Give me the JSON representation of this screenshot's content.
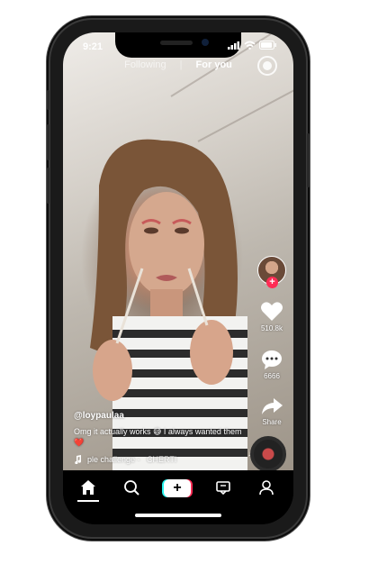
{
  "status_bar": {
    "time": "9:21"
  },
  "top_nav": {
    "following_label": "Following",
    "for_you_label": "For you"
  },
  "sidebar": {
    "follow_symbol": "+",
    "likes_count": "510.8k",
    "comments_count": "6666",
    "share_label": "Share"
  },
  "caption": {
    "username": "@loypaulaa",
    "description": "Omg it actually works 😅 I always wanted them ❤️",
    "music_text": "ple challenge -   CHERTI"
  },
  "bottom_nav": {
    "items": [
      "home-icon",
      "discover-icon",
      "create-icon",
      "inbox-icon",
      "profile-icon"
    ],
    "create_symbol": "+"
  },
  "colors": {
    "accent_red": "#fe2c55",
    "accent_cyan": "#25f4ee",
    "screen_bg": "#000000"
  }
}
